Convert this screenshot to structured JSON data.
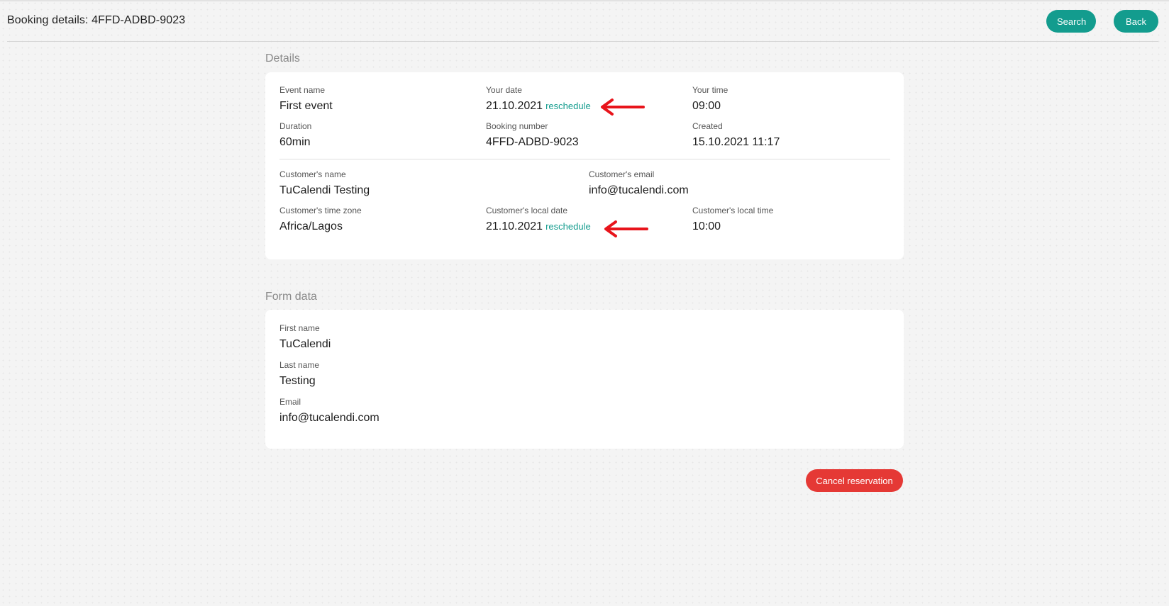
{
  "header": {
    "title": "Booking details: 4FFD-ADBD-9023",
    "search_label": "Search",
    "back_label": "Back"
  },
  "details": {
    "title": "Details",
    "event_name_label": "Event name",
    "event_name": "First event",
    "your_date_label": "Your date",
    "your_date": "21.10.2021",
    "reschedule_label": "reschedule",
    "your_time_label": "Your time",
    "your_time": "09:00",
    "duration_label": "Duration",
    "duration": "60min",
    "booking_number_label": "Booking number",
    "booking_number": "4FFD-ADBD-9023",
    "created_label": "Created",
    "created": "15.10.2021 11:17",
    "customer_name_label": "Customer's name",
    "customer_name": "TuCalendi Testing",
    "customer_email_label": "Customer's email",
    "customer_email": "info@tucalendi.com",
    "customer_timezone_label": "Customer's time zone",
    "customer_timezone": "Africa/Lagos",
    "customer_local_date_label": "Customer's local date",
    "customer_local_date": "21.10.2021",
    "customer_local_time_label": "Customer's local time",
    "customer_local_time": "10:00"
  },
  "form_data": {
    "title": "Form data",
    "first_name_label": "First name",
    "first_name": "TuCalendi",
    "last_name_label": "Last name",
    "last_name": "Testing",
    "email_label": "Email",
    "email": "info@tucalendi.com"
  },
  "actions": {
    "cancel_label": "Cancel reservation"
  },
  "colors": {
    "accent": "#139c8e",
    "danger": "#e53935",
    "annotation_arrow": "#e8141b"
  },
  "icons": {
    "annotation": "red-arrow-left-icon"
  }
}
